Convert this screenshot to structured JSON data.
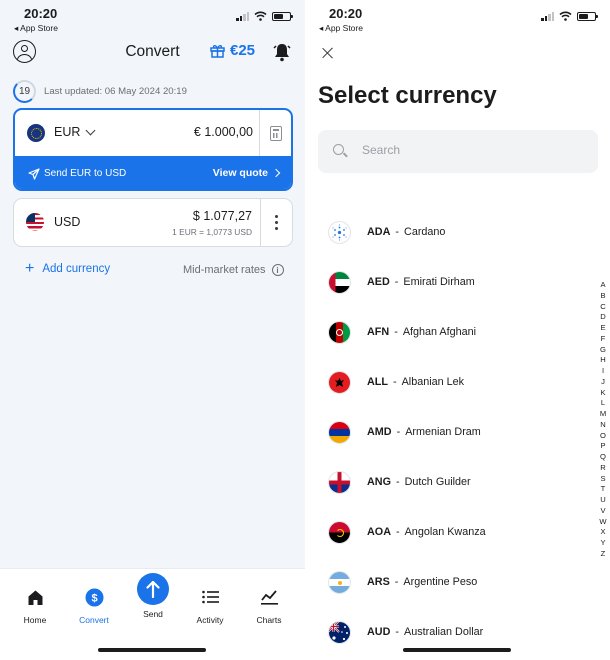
{
  "status": {
    "time": "20:20",
    "back_app": "◂ App Store"
  },
  "convert": {
    "title": "Convert",
    "reward_amount": "€25",
    "timer_seconds": "19",
    "last_updated": "Last updated: 06 May 2024 20:19",
    "from": {
      "code": "EUR",
      "amount": "€ 1.000,00",
      "send_label": "Send EUR to USD",
      "quote_label": "View quote"
    },
    "to": {
      "code": "USD",
      "amount": "$ 1.077,27",
      "rate": "1 EUR = 1,0773 USD"
    },
    "add_currency": "Add currency",
    "midmarket": "Mid-market rates"
  },
  "tabs": [
    "Home",
    "Convert",
    "Send",
    "Activity",
    "Charts"
  ],
  "select": {
    "title": "Select currency",
    "search_placeholder": "Search",
    "currencies": [
      {
        "code": "ADA",
        "name": "Cardano"
      },
      {
        "code": "AED",
        "name": "Emirati Dirham"
      },
      {
        "code": "AFN",
        "name": "Afghan Afghani"
      },
      {
        "code": "ALL",
        "name": "Albanian Lek"
      },
      {
        "code": "AMD",
        "name": "Armenian Dram"
      },
      {
        "code": "ANG",
        "name": "Dutch Guilder"
      },
      {
        "code": "AOA",
        "name": "Angolan Kwanza"
      },
      {
        "code": "ARS",
        "name": "Argentine Peso"
      },
      {
        "code": "AUD",
        "name": "Australian Dollar"
      }
    ],
    "separator": "-",
    "alphabet": [
      "A",
      "B",
      "C",
      "D",
      "E",
      "F",
      "G",
      "H",
      "I",
      "J",
      "K",
      "L",
      "M",
      "N",
      "O",
      "P",
      "Q",
      "R",
      "S",
      "T",
      "U",
      "V",
      "W",
      "X",
      "Y",
      "Z"
    ]
  },
  "colors": {
    "accent": "#1a73e8",
    "background": "#f2f5f9"
  },
  "icons": [
    "profile-icon",
    "gift-icon",
    "bell-icon",
    "calculator-icon",
    "send-plane-icon",
    "more-icon",
    "info-icon",
    "home-icon",
    "convert-icon",
    "send-arrow-icon",
    "activity-icon",
    "charts-icon",
    "close-icon",
    "search-icon"
  ]
}
